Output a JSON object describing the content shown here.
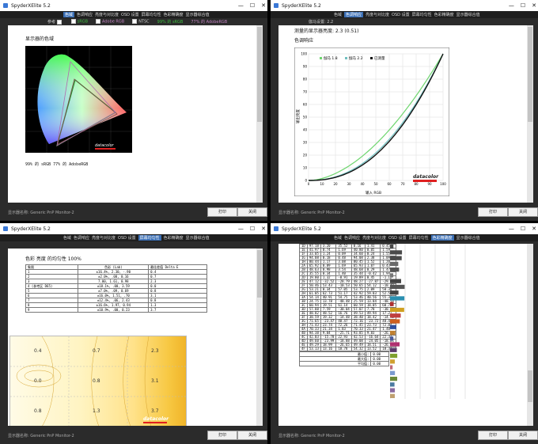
{
  "common": {
    "app_title": "SpyderXElite 5.2",
    "tabs": [
      "色域",
      "色调响应",
      "亮度与对比度",
      "OSD 设置",
      "屏幕均匀性",
      "色彩精确度",
      "显示器综合值"
    ],
    "display_label": "显示器名称: Generic PnP Monitor-2",
    "print_label": "打印",
    "close_label": "关闭",
    "minimize_glyph": "—",
    "maximize_glyph": "☐",
    "close_glyph": "✕"
  },
  "gamut_window": {
    "active_tab": 0,
    "options": [
      {
        "label": "参考",
        "checked": true
      },
      {
        "label": "sRGB",
        "checked": true,
        "color": "#2e9b2e"
      },
      {
        "label": "Adobe RGB",
        "checked": false,
        "color": "#b06bb0"
      },
      {
        "label": "NTSC",
        "checked": false
      },
      {
        "label": "99% 的 sRGB",
        "checked": false,
        "color": "#2e9b2e"
      },
      {
        "label": "77% 的 AdobeRGB",
        "checked": false,
        "color": "#b06bb0"
      }
    ],
    "heading": "显示器的色域",
    "result": "99% 的 sRGB      77% 的 AdobeRGB",
    "logo": "datacolor"
  },
  "tone_window": {
    "active_tab": 1,
    "gamma_label": "伽马设置: 2.2",
    "measured_line": "测量的显示器亮度: 2.3 (0.51)",
    "heading": "色调响应",
    "legend": [
      "伽马 1.8",
      "伽马 2.2",
      "已测量"
    ],
    "ylabel": "输出亮度",
    "xlabel": "输入 RGB",
    "logo": "datacolor"
  },
  "uniformity_window": {
    "active_tab": 4,
    "heading": "色彩 亮度 的均匀性 100%",
    "table_headers": [
      "象限",
      "色彩 (Lab)",
      "最佳差值 Delta E"
    ],
    "table_rows": [
      [
        "1",
        "±16.4%,  2.30,  -.90",
        "0.4"
      ],
      [
        "2",
        "±2.0%,  .08,  0.16",
        "0.7"
      ],
      [
        "3",
        "7.00,  1.61,  0.98",
        "2.3"
      ],
      [
        "4 (参考区 D65)",
        "±18.1%,  .00,  3.59",
        "0.0"
      ],
      [
        "5",
        "±7.0%,  .09,  0.69",
        "0.8"
      ],
      [
        "6",
        "±16.0%,  1.51,  .70",
        "3.1"
      ],
      [
        "7",
        "±12.4%,  .06,  2.43",
        "0.8"
      ],
      [
        "8",
        "±16.6%,  1.97,  0.94",
        "1.3"
      ],
      [
        "9",
        "±10.9%,  .00,  0.23",
        "3.7"
      ]
    ],
    "grid_values": [
      [
        "0.4",
        "0.7",
        "2.3"
      ],
      [
        "0.0",
        "0.8",
        "3.1"
      ],
      [
        "0.8",
        "1.3",
        "3.7"
      ]
    ],
    "logo": "datacolor"
  },
  "accuracy_window": {
    "active_tab": 5,
    "rows": [
      [
        "1D",
        "97.18",
        "3.20",
        "35.52",
        "0.16",
        "1.41",
        "0.45"
      ],
      [
        "1E",
        "41.97",
        "0.74",
        "1.69",
        "40.80",
        "0.05",
        "1.59"
      ],
      [
        "1F",
        "33.05",
        "1.24",
        "0.09",
        "34.60",
        "0.24",
        "1.55"
      ],
      [
        "1G",
        "94.08",
        "0.18",
        "0.48",
        "94.08",
        "2.38",
        "1.09"
      ],
      [
        "1H",
        "80.44",
        "1.17",
        "3.08",
        "80.45",
        "1.52",
        "1.20"
      ],
      [
        "2A",
        "65.92",
        "0.89",
        "1.69",
        "65.93",
        "1.07",
        "0.43"
      ],
      [
        "2B",
        "48.63",
        "0.98",
        "3.54",
        "48.68",
        "0.29",
        "1.47"
      ],
      [
        "2C",
        "35.55",
        "0.34",
        "1.40",
        "35.44",
        "-0.42",
        "1.94"
      ],
      [
        "2D",
        "19.80",
        "1.32",
        "-0.91",
        "19.89",
        "0.45",
        "-1.12"
      ],
      [
        "2E",
        "47.12",
        "-32.52",
        "-28.79",
        "48.27",
        "-27.87",
        "-29.12"
      ],
      [
        "2F",
        "50.46",
        "53.43",
        "-10.53",
        "50.65",
        "54.12",
        "-10.48"
      ],
      [
        "2G",
        "53.21",
        "0.34",
        "57.05",
        "53.75",
        "2.09",
        "58.36"
      ],
      [
        "2H",
        "61.05",
        "62.73",
        "51.17",
        "42.92",
        "59.83",
        "52.59"
      ],
      [
        "3A",
        "54.14",
        "40.91",
        "54.75",
        "53.46",
        "40.56",
        "55.35"
      ],
      [
        "3B",
        "24.75",
        "13.78",
        "-48.48",
        "25.59",
        "13.84",
        "-48.58"
      ],
      [
        "3C",
        "60.94",
        "19.51",
        "61.14",
        "60.59",
        "18.05",
        "60.72"
      ],
      [
        "3D",
        "57.88",
        "7.59",
        "-30.04",
        "57.07",
        "7.78",
        "-30.27"
      ],
      [
        "3E",
        "48.82",
        "48.52",
        "16.76",
        "49.53",
        "49.94",
        "17.27"
      ],
      [
        "3F",
        "38.59",
        "19.32",
        "-14.48",
        "38.40",
        "18.42",
        "-14.40"
      ],
      [
        "3G",
        "71.65",
        "-23.47",
        "48.47",
        "72.16",
        "-23.72",
        "48.44"
      ],
      [
        "3H",
        "71.43",
        "23.74",
        "72.26",
        "71.45",
        "23.73",
        "72.84"
      ],
      [
        "4A",
        "70.33",
        "21.34",
        "1.83",
        "70.33",
        "21.47",
        "1.48"
      ],
      [
        "4B",
        "94.38",
        "9.84",
        "-25.71",
        "93.85",
        "9.83",
        "-26.08"
      ],
      [
        "4C",
        "42.03",
        "-15.78",
        "22.93",
        "42.53",
        "-16.64",
        "22.31"
      ],
      [
        "4D",
        "49.60",
        "-23.99",
        "-18.88",
        "49.08",
        "-24.05",
        "-18.64"
      ],
      [
        "4E",
        "49.29",
        "18.99",
        "-26.65",
        "49.49",
        "18.51",
        "-26.44"
      ],
      [
        "4F",
        "53.13",
        "13.16",
        "18.78",
        "54.32",
        "13.52",
        "18.32"
      ]
    ],
    "bars": [
      0.45,
      1.59,
      1.55,
      1.09,
      1.2,
      0.43,
      1.47,
      1.94,
      1.12,
      1.91,
      0.48,
      1.88,
      1.42,
      1.3,
      0.84,
      0.71,
      0.44,
      1.27,
      0.9,
      0.96,
      0.63,
      0.34,
      0.65,
      0.95,
      0.59,
      0.64,
      0.63
    ],
    "summary": [
      [
        "最小值:",
        "0.00"
      ],
      [
        "最大值:",
        "0.00"
      ],
      [
        "平均值:",
        "0.00"
      ]
    ]
  }
}
